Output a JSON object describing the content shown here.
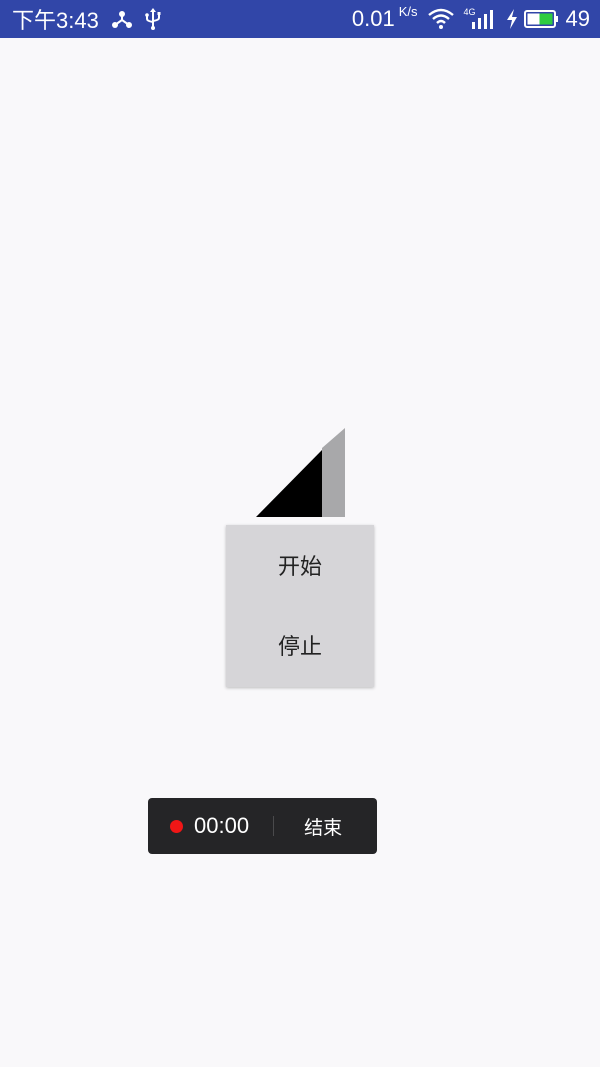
{
  "status_bar": {
    "time": "下午3:43",
    "net_speed": "0.01",
    "net_unit": "K/s",
    "network_type": "4G",
    "battery": "49",
    "icons": [
      "share-icon",
      "usb-icon",
      "wifi-icon",
      "signal-icon",
      "charging-icon",
      "battery-icon"
    ]
  },
  "menu": {
    "start_label": "开始",
    "stop_label": "停止"
  },
  "recorder": {
    "time": "00:00",
    "end_label": "结束"
  },
  "colors": {
    "status_bar_bg": "#3146a8",
    "page_bg": "#f9f8fa",
    "menu_bg": "#d6d5d8",
    "recorder_bg": "#252527",
    "record_dot": "#f01616",
    "battery_fill": "#2ecc40"
  }
}
